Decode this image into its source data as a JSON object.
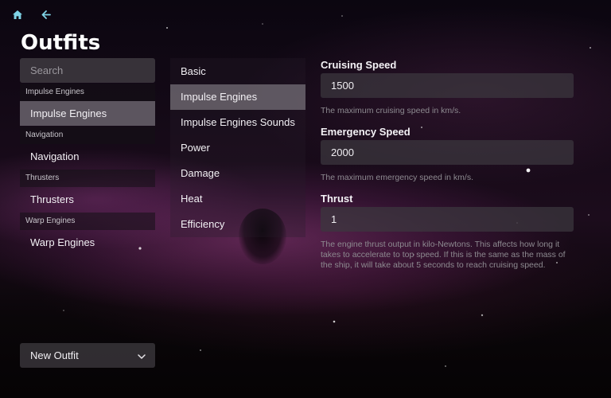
{
  "nav": {
    "home_icon": "home-icon",
    "back_icon": "back-arrow-icon",
    "accent": "#7fd3e6"
  },
  "page": {
    "title": "Outfits"
  },
  "search": {
    "placeholder": "Search",
    "value": ""
  },
  "left_list": {
    "groups": [
      {
        "header": "Impulse Engines",
        "item": "Impulse Engines",
        "selected": true
      },
      {
        "header": "Navigation",
        "item": "Navigation",
        "selected": false
      },
      {
        "header": "Thrusters",
        "item": "Thrusters",
        "selected": false
      },
      {
        "header": "Warp Engines",
        "item": "Warp Engines",
        "selected": false
      }
    ]
  },
  "new_outfit": {
    "label": "New Outfit",
    "icon": "chevron-down-icon"
  },
  "categories": {
    "items": [
      {
        "label": "Basic",
        "selected": false
      },
      {
        "label": "Impulse Engines",
        "selected": true
      },
      {
        "label": "Impulse Engines Sounds",
        "selected": false
      },
      {
        "label": "Power",
        "selected": false
      },
      {
        "label": "Damage",
        "selected": false
      },
      {
        "label": "Heat",
        "selected": false
      },
      {
        "label": "Efficiency",
        "selected": false
      }
    ]
  },
  "form": {
    "cruising": {
      "label": "Cruising Speed",
      "value": "1500",
      "help": "The maximum cruising speed in km/s."
    },
    "emergency": {
      "label": "Emergency Speed",
      "value": "2000",
      "help": "The maximum emergency speed in km/s."
    },
    "thrust": {
      "label": "Thrust",
      "value": "1",
      "help": "The engine thrust output in kilo-Newtons. This affects how long it takes to accelerate to top speed. If this is the same as the mass of the ship, it will take about 5 seconds to reach cruising speed."
    }
  }
}
